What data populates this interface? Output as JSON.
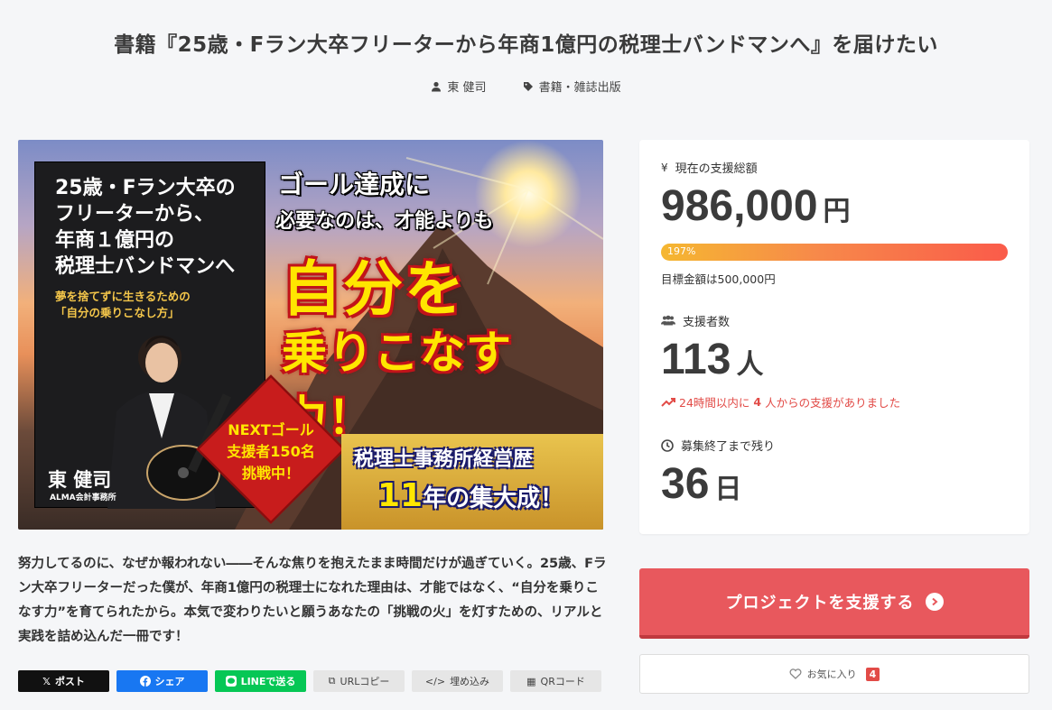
{
  "project": {
    "title": "書籍『25歳・Fラン大卒フリーターから年商1億円の税理士バンドマンへ』を届けたい",
    "author": "東 健司",
    "category": "書籍・雑誌出版"
  },
  "hero": {
    "book_title": "25歳・Fラン大卒の\nフリーターから、\n年商１億円の\n税理士バンドマンへ",
    "book_subtitle": "夢を捨てずに生きるための\n「自分の乗りこなし方」",
    "author_name": "東 健司",
    "author_company": "ALMA会計事務所",
    "headline_1": "ゴール達成に",
    "headline_2": "必要なのは、才能よりも",
    "big_1": "自分を",
    "big_2": "乗りこなす力！",
    "next_goal": "NEXTゴール\n支援者150名\n挑戦中！",
    "banner_1": "税理士事務所経営歴",
    "banner_2_num": "11",
    "banner_2_text": "年の集大成！"
  },
  "description": "努力してるのに、なぜか報われない――そんな焦りを抱えたまま時間だけが過ぎていく。25歳、Fラン大卒フリーターだった僕が、年商1億円の税理士になれた理由は、才能ではなく、“自分を乗りこなす力”を育てられたから。本気で変わりたいと願うあなたの「挑戦の火」を灯すための、リアルと実践を詰め込んだ一冊です！",
  "share": {
    "x": "ポスト",
    "facebook": "シェア",
    "line": "LINEで送る",
    "url": "URLコピー",
    "embed": "埋め込み",
    "qr": "QRコード"
  },
  "stats": {
    "amount_label": "現在の支援総額",
    "amount_value": "986,000",
    "amount_unit": "円",
    "progress_label": "197%",
    "progress_fraction": 1.0,
    "goal_text": "目標金額は500,000円",
    "backers_label": "支援者数",
    "backers_value": "113",
    "backers_unit": "人",
    "recent_prefix": "24時間以内に",
    "recent_count": "4",
    "recent_suffix": "人からの支援がありました",
    "remaining_label": "募集終了まで残り",
    "remaining_value": "36",
    "remaining_unit": "日"
  },
  "actions": {
    "support_label": "プロジェクトを支援する",
    "favorite_label": "お気に入り",
    "favorite_count": "4"
  },
  "colors": {
    "accent": "#e8585d",
    "alert": "#e24b47",
    "background": "#f5f6f8"
  }
}
